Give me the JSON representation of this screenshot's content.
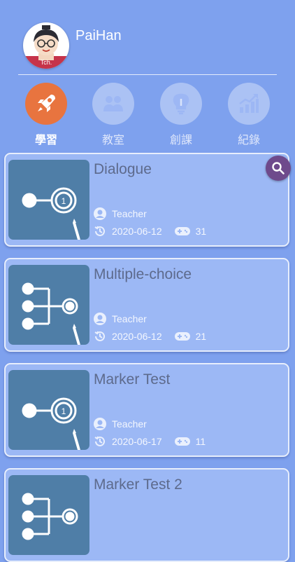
{
  "profile": {
    "username": "PaiHan",
    "avatar_badge": "Tch."
  },
  "nav": [
    {
      "label": "學習",
      "icon": "rocket-icon",
      "active": true
    },
    {
      "label": "教室",
      "icon": "group-icon",
      "active": false
    },
    {
      "label": "創課",
      "icon": "lightbulb-icon",
      "active": false
    },
    {
      "label": "紀錄",
      "icon": "chart-icon",
      "active": false
    }
  ],
  "courses": [
    {
      "title": "Dialogue",
      "author": "Teacher",
      "date": "2020-06-12",
      "plays": "31",
      "thumb": "dialogue-icon"
    },
    {
      "title": "Multiple-choice",
      "author": "Teacher",
      "date": "2020-06-12",
      "plays": "21",
      "thumb": "multiple-choice-icon"
    },
    {
      "title": "Marker Test",
      "author": "Teacher",
      "date": "2020-06-17",
      "plays": "11",
      "thumb": "dialogue-icon"
    },
    {
      "title": "Marker Test 2",
      "author": "",
      "date": "",
      "plays": "",
      "thumb": "multiple-choice-icon"
    }
  ],
  "colors": {
    "background": "#7ea1ee",
    "active_tab": "#e8743f",
    "card": "#9cb8f5",
    "thumb": "#4f7ea7",
    "search_button": "#6e4a8c"
  }
}
